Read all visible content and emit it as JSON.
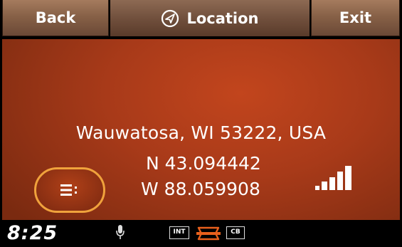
{
  "header": {
    "back_label": "Back",
    "title": "Location",
    "title_icon": "compass-icon",
    "exit_label": "Exit"
  },
  "location": {
    "address": "Wauwatosa, WI 53222, USA",
    "latitude": "N 43.094442",
    "longitude": "W 88.059908",
    "signal_icon": "signal-strength-icon",
    "signal_level": 4
  },
  "menu_button": {
    "icon": "list-menu-icon"
  },
  "status_bar": {
    "clock": "8:25",
    "mic_icon": "microphone-icon",
    "int_label": "INT",
    "logo_icon": "brand-logo-icon",
    "cb_label": "CB"
  },
  "colors": {
    "panel": "#a83a19",
    "header_button": "#876147",
    "accent_border": "#f0a23c",
    "logo": "#e8601c"
  }
}
